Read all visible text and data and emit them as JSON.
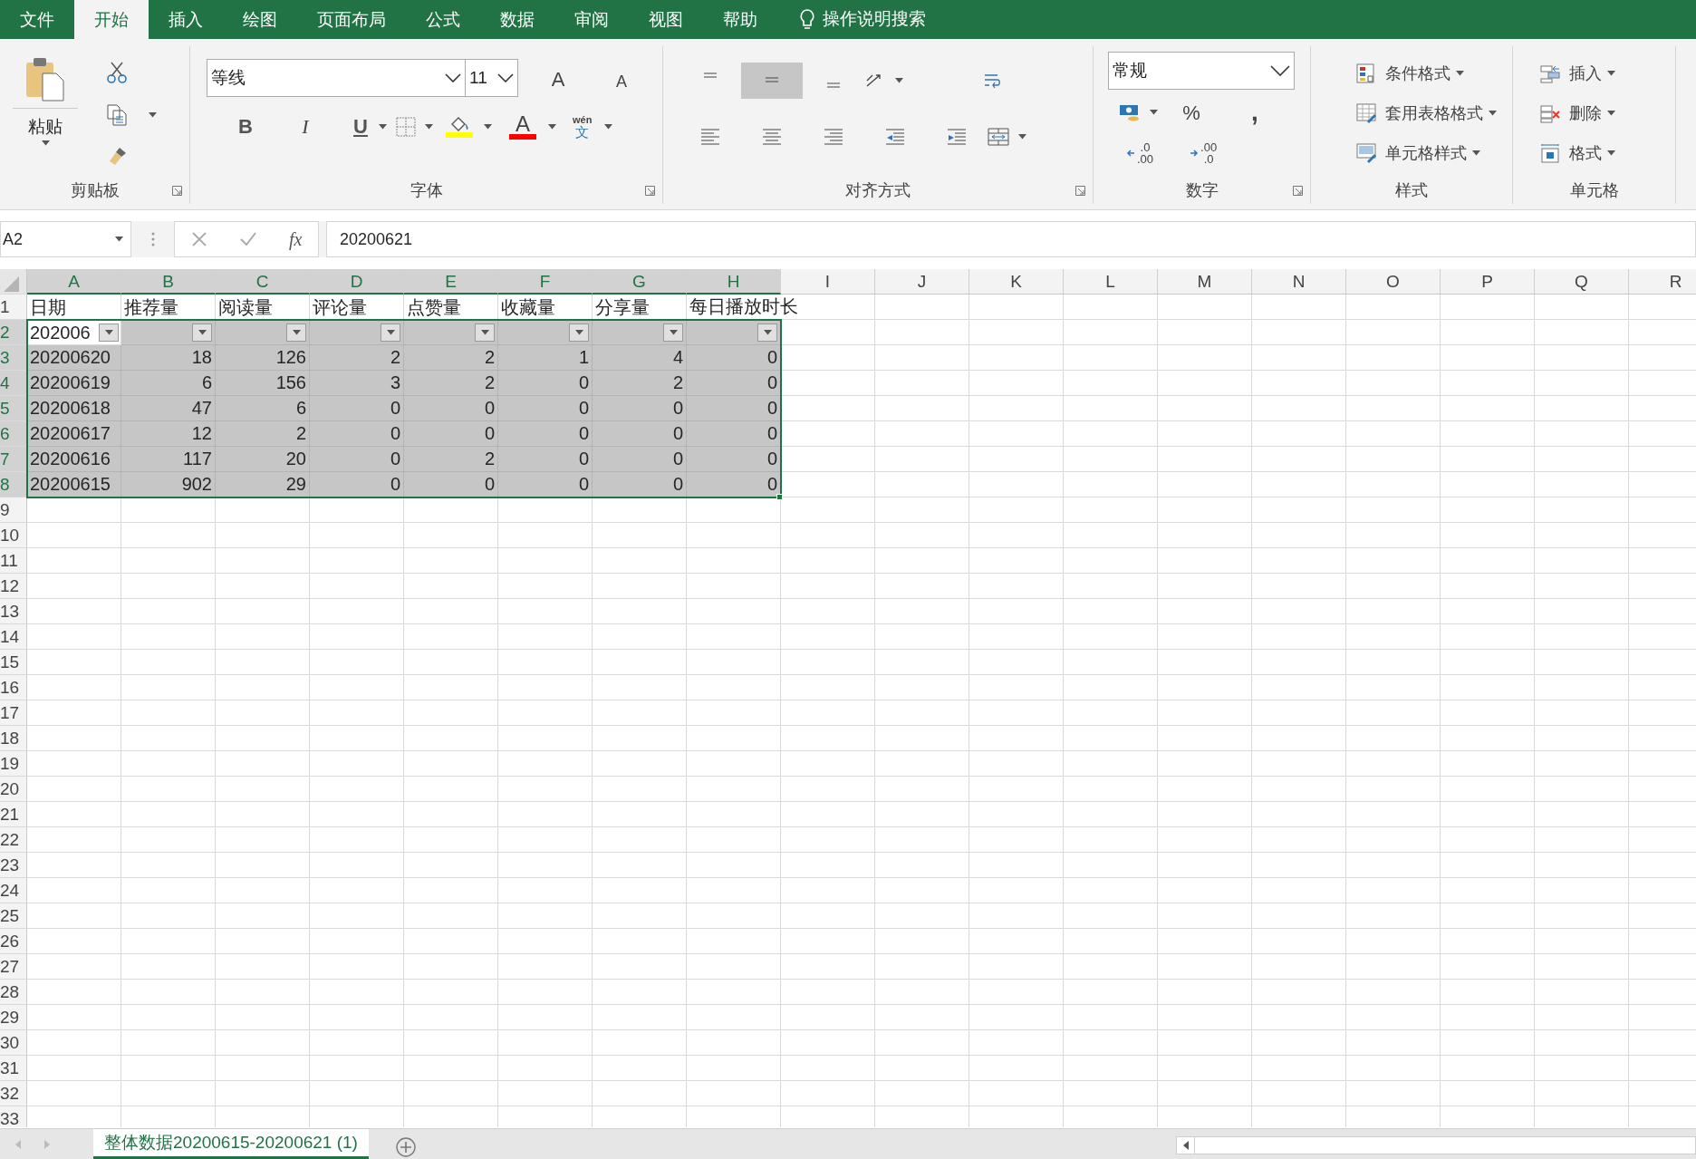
{
  "ribbon_tabs": [
    {
      "label": "文件",
      "selected": false
    },
    {
      "label": "开始",
      "selected": true
    },
    {
      "label": "插入",
      "selected": false
    },
    {
      "label": "绘图",
      "selected": false
    },
    {
      "label": "页面布局",
      "selected": false
    },
    {
      "label": "公式",
      "selected": false
    },
    {
      "label": "数据",
      "selected": false
    },
    {
      "label": "审阅",
      "selected": false
    },
    {
      "label": "视图",
      "selected": false
    },
    {
      "label": "帮助",
      "selected": false
    }
  ],
  "tell_me": "操作说明搜索",
  "clipboard": {
    "paste": "粘贴",
    "label": "剪贴板"
  },
  "font": {
    "name": "等线",
    "size": "11",
    "label": "字体",
    "size_buttons": [
      {
        "kind": "grow",
        "text": "A"
      },
      {
        "kind": "shrink",
        "text": "A"
      }
    ],
    "format_buttons": [
      {
        "kind": "bold",
        "text": "B"
      },
      {
        "kind": "italic",
        "text": "I"
      },
      {
        "kind": "underline",
        "text": "U"
      },
      {
        "kind": "borders"
      },
      {
        "kind": "fill",
        "color": "#ffff00"
      },
      {
        "kind": "font-color",
        "text": "A",
        "color": "#ff0000"
      },
      {
        "kind": "phonetic",
        "text": "wén",
        "sub": "文"
      }
    ]
  },
  "alignment": {
    "label": "对齐方式",
    "buttons": [
      {
        "kind": "top",
        "on": false
      },
      {
        "kind": "middle",
        "on": true
      },
      {
        "kind": "bottom",
        "on": false
      },
      {
        "kind": "orientation",
        "on": false
      },
      {
        "kind": "wrap",
        "on": false
      },
      {
        "kind": "left",
        "on": false
      },
      {
        "kind": "center",
        "on": false
      },
      {
        "kind": "right",
        "on": false
      },
      {
        "kind": "outdent",
        "on": false
      },
      {
        "kind": "indent",
        "on": false
      },
      {
        "kind": "merge",
        "on": false
      }
    ]
  },
  "number": {
    "format": "常规",
    "label": "数字",
    "buttons": [
      {
        "kind": "accounting"
      },
      {
        "kind": "percent",
        "text": "%"
      },
      {
        "kind": "comma",
        "text": ","
      },
      {
        "kind": "increase-decimal",
        "lines": [
          ".0",
          ".00"
        ]
      },
      {
        "kind": "decrease-decimal",
        "lines": [
          ".00",
          ".0"
        ]
      }
    ]
  },
  "styles": {
    "label": "样式",
    "items": [
      {
        "kind": "conditional",
        "label": "条件格式"
      },
      {
        "kind": "table",
        "label": "套用表格格式"
      },
      {
        "kind": "cell-style",
        "label": "单元格样式"
      }
    ]
  },
  "cells": {
    "label": "单元格",
    "items": [
      {
        "kind": "insert",
        "label": "插入"
      },
      {
        "kind": "delete",
        "label": "删除"
      },
      {
        "kind": "format",
        "label": "格式"
      }
    ]
  },
  "formula_bar": {
    "name_box": "A2",
    "function_label": "fx",
    "value": "20200621"
  },
  "sheet": {
    "columns": [
      {
        "label": "A",
        "selected": true,
        "numeric": false
      },
      {
        "label": "B",
        "selected": true,
        "numeric": true
      },
      {
        "label": "C",
        "selected": true,
        "numeric": true
      },
      {
        "label": "D",
        "selected": true,
        "numeric": true
      },
      {
        "label": "E",
        "selected": true,
        "numeric": true
      },
      {
        "label": "F",
        "selected": true,
        "numeric": true
      },
      {
        "label": "G",
        "selected": true,
        "numeric": true
      },
      {
        "label": "H",
        "selected": true,
        "numeric": true
      },
      {
        "label": "I",
        "selected": false
      },
      {
        "label": "J",
        "selected": false
      },
      {
        "label": "K",
        "selected": false
      },
      {
        "label": "L",
        "selected": false
      },
      {
        "label": "M",
        "selected": false
      },
      {
        "label": "N",
        "selected": false
      },
      {
        "label": "O",
        "selected": false
      },
      {
        "label": "P",
        "selected": false
      },
      {
        "label": "Q",
        "selected": false
      },
      {
        "label": "R",
        "selected": false
      }
    ],
    "rows": [
      {
        "number": "1",
        "selected": false,
        "kind": "header",
        "cells": [
          "日期",
          "推荐量",
          "阅读量",
          "评论量",
          "点赞量",
          "收藏量",
          "分享量",
          "每日播放时长"
        ]
      },
      {
        "number": "2",
        "selected": true,
        "kind": "filter",
        "cells": [
          "202006"
        ]
      },
      {
        "number": "3",
        "selected": true,
        "kind": "data",
        "cells": [
          "20200620",
          "18",
          "126",
          "2",
          "2",
          "1",
          "4",
          "0"
        ]
      },
      {
        "number": "4",
        "selected": true,
        "kind": "data",
        "cells": [
          "20200619",
          "6",
          "156",
          "3",
          "2",
          "0",
          "2",
          "0"
        ]
      },
      {
        "number": "5",
        "selected": true,
        "kind": "data",
        "cells": [
          "20200618",
          "47",
          "6",
          "0",
          "0",
          "0",
          "0",
          "0"
        ]
      },
      {
        "number": "6",
        "selected": true,
        "kind": "data",
        "cells": [
          "20200617",
          "12",
          "2",
          "0",
          "0",
          "0",
          "0",
          "0"
        ]
      },
      {
        "number": "7",
        "selected": true,
        "kind": "data",
        "cells": [
          "20200616",
          "117",
          "20",
          "0",
          "2",
          "0",
          "0",
          "0"
        ]
      },
      {
        "number": "8",
        "selected": true,
        "kind": "data",
        "cells": [
          "20200615",
          "902",
          "29",
          "0",
          "0",
          "0",
          "0",
          "0"
        ]
      },
      {
        "number": "9",
        "selected": false,
        "kind": "empty"
      },
      {
        "number": "10",
        "selected": false,
        "kind": "empty"
      },
      {
        "number": "11",
        "selected": false,
        "kind": "empty"
      },
      {
        "number": "12",
        "selected": false,
        "kind": "empty"
      },
      {
        "number": "13",
        "selected": false,
        "kind": "empty"
      },
      {
        "number": "14",
        "selected": false,
        "kind": "empty"
      },
      {
        "number": "15",
        "selected": false,
        "kind": "empty"
      },
      {
        "number": "16",
        "selected": false,
        "kind": "empty"
      },
      {
        "number": "17",
        "selected": false,
        "kind": "empty"
      },
      {
        "number": "18",
        "selected": false,
        "kind": "empty"
      },
      {
        "number": "19",
        "selected": false,
        "kind": "empty"
      },
      {
        "number": "20",
        "selected": false,
        "kind": "empty"
      },
      {
        "number": "21",
        "selected": false,
        "kind": "empty"
      },
      {
        "number": "22",
        "selected": false,
        "kind": "empty"
      },
      {
        "number": "23",
        "selected": false,
        "kind": "empty"
      },
      {
        "number": "24",
        "selected": false,
        "kind": "empty"
      },
      {
        "number": "25",
        "selected": false,
        "kind": "empty"
      },
      {
        "number": "26",
        "selected": false,
        "kind": "empty"
      },
      {
        "number": "27",
        "selected": false,
        "kind": "empty"
      },
      {
        "number": "28",
        "selected": false,
        "kind": "empty"
      },
      {
        "number": "29",
        "selected": false,
        "kind": "empty"
      },
      {
        "number": "30",
        "selected": false,
        "kind": "empty"
      },
      {
        "number": "31",
        "selected": false,
        "kind": "empty"
      },
      {
        "number": "32",
        "selected": false,
        "kind": "empty"
      },
      {
        "number": "33",
        "selected": false,
        "kind": "empty"
      }
    ]
  },
  "sheet_tabs": [
    {
      "label": "整体数据20200615-20200621 (1)",
      "selected": true
    }
  ]
}
